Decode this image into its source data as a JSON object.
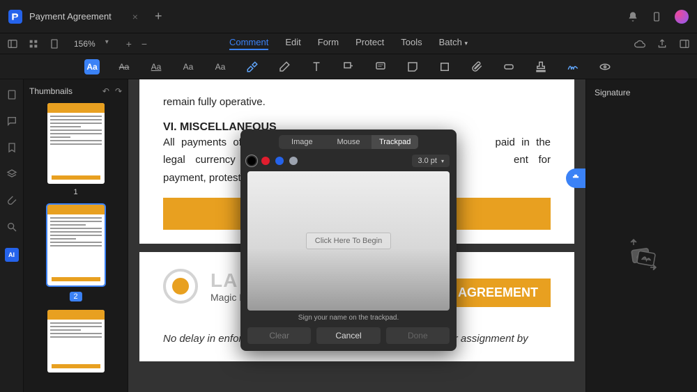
{
  "titlebar": {
    "tab_name": "Payment Agreement"
  },
  "quickbar": {
    "zoom_label": "156%"
  },
  "menubar": {
    "comment": "Comment",
    "edit": "Edit",
    "form": "Form",
    "protect": "Protect",
    "tools": "Tools",
    "batch": "Batch"
  },
  "thumbnails": {
    "header": "Thumbnails",
    "page1_num": "1",
    "page2_num": "2"
  },
  "rightpanel": {
    "title": "Signature"
  },
  "document": {
    "page1": {
      "frag_top": "remain fully operative.",
      "heading": "VI. MISCELLANEOUS",
      "para_start": "All payments of",
      "para_mid": "paid in the legal currency of the",
      "para_mid2": "ent for payment, protest, and a n"
    },
    "page2": {
      "logo_title": "LA",
      "tagline": "Magic Happens With Content",
      "agreement_label": "AGREEMENT",
      "body": "No delay in enforcing any right of the Lender under this Note, or assignment by"
    }
  },
  "modal": {
    "tabs": {
      "image": "Image",
      "mouse": "Mouse",
      "trackpad": "Trackpad"
    },
    "stroke": "3.0 pt",
    "begin": "Click Here To Begin",
    "hint": "Sign your name on the trackpad.",
    "clear": "Clear",
    "cancel": "Cancel",
    "done": "Done",
    "colors": {
      "black": "#000000",
      "red": "#e11d2e",
      "blue": "#2563eb",
      "gray": "#9ca3af"
    }
  }
}
